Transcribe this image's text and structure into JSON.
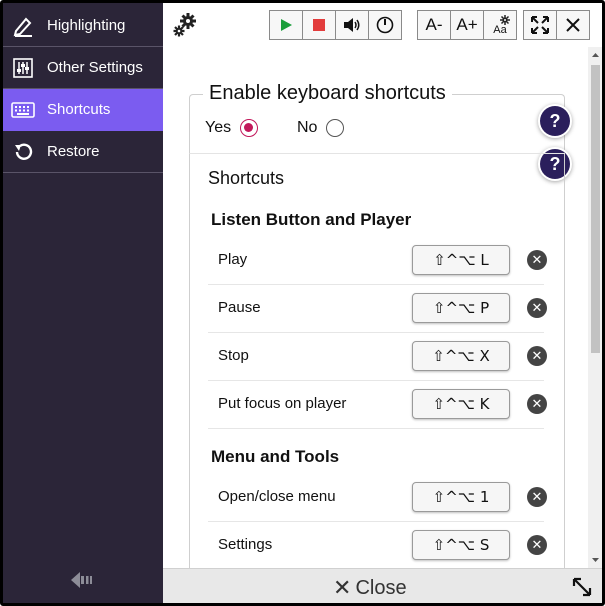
{
  "sidebar": {
    "items": [
      {
        "label": "Highlighting",
        "icon": "highlighter-icon"
      },
      {
        "label": "Other Settings",
        "icon": "sliders-icon"
      },
      {
        "label": "Shortcuts",
        "icon": "keyboard-icon"
      },
      {
        "label": "Restore",
        "icon": "restore-icon"
      }
    ],
    "active_index": 2
  },
  "toolbar": {
    "font_decrease": "A-",
    "font_increase": "A+",
    "text_settings": "Aa"
  },
  "keyboard": {
    "legend": "Enable keyboard shortcuts",
    "yes_label": "Yes",
    "no_label": "No",
    "selected": "Yes"
  },
  "help_label": "?",
  "shortcuts": {
    "title": "Shortcuts",
    "sections": [
      {
        "title": "Listen Button and Player",
        "items": [
          {
            "label": "Play",
            "keys": "⇧^⌥ L"
          },
          {
            "label": "Pause",
            "keys": "⇧^⌥ P"
          },
          {
            "label": "Stop",
            "keys": "⇧^⌥ X"
          },
          {
            "label": "Put focus on player",
            "keys": "⇧^⌥ K"
          }
        ]
      },
      {
        "title": "Menu and Tools",
        "items": [
          {
            "label": "Open/close menu",
            "keys": "⇧^⌥ 1"
          },
          {
            "label": "Settings",
            "keys": "⇧^⌥ S"
          }
        ]
      }
    ]
  },
  "footer": {
    "close_label": "Close"
  },
  "colors": {
    "sidebar_bg": "#2b2538",
    "active_item": "#7b5cf0",
    "radio_checked": "#c2185b",
    "help_bg": "#2b1f5c",
    "play_green": "#1a9e3a",
    "stop_red": "#e23c3c"
  }
}
